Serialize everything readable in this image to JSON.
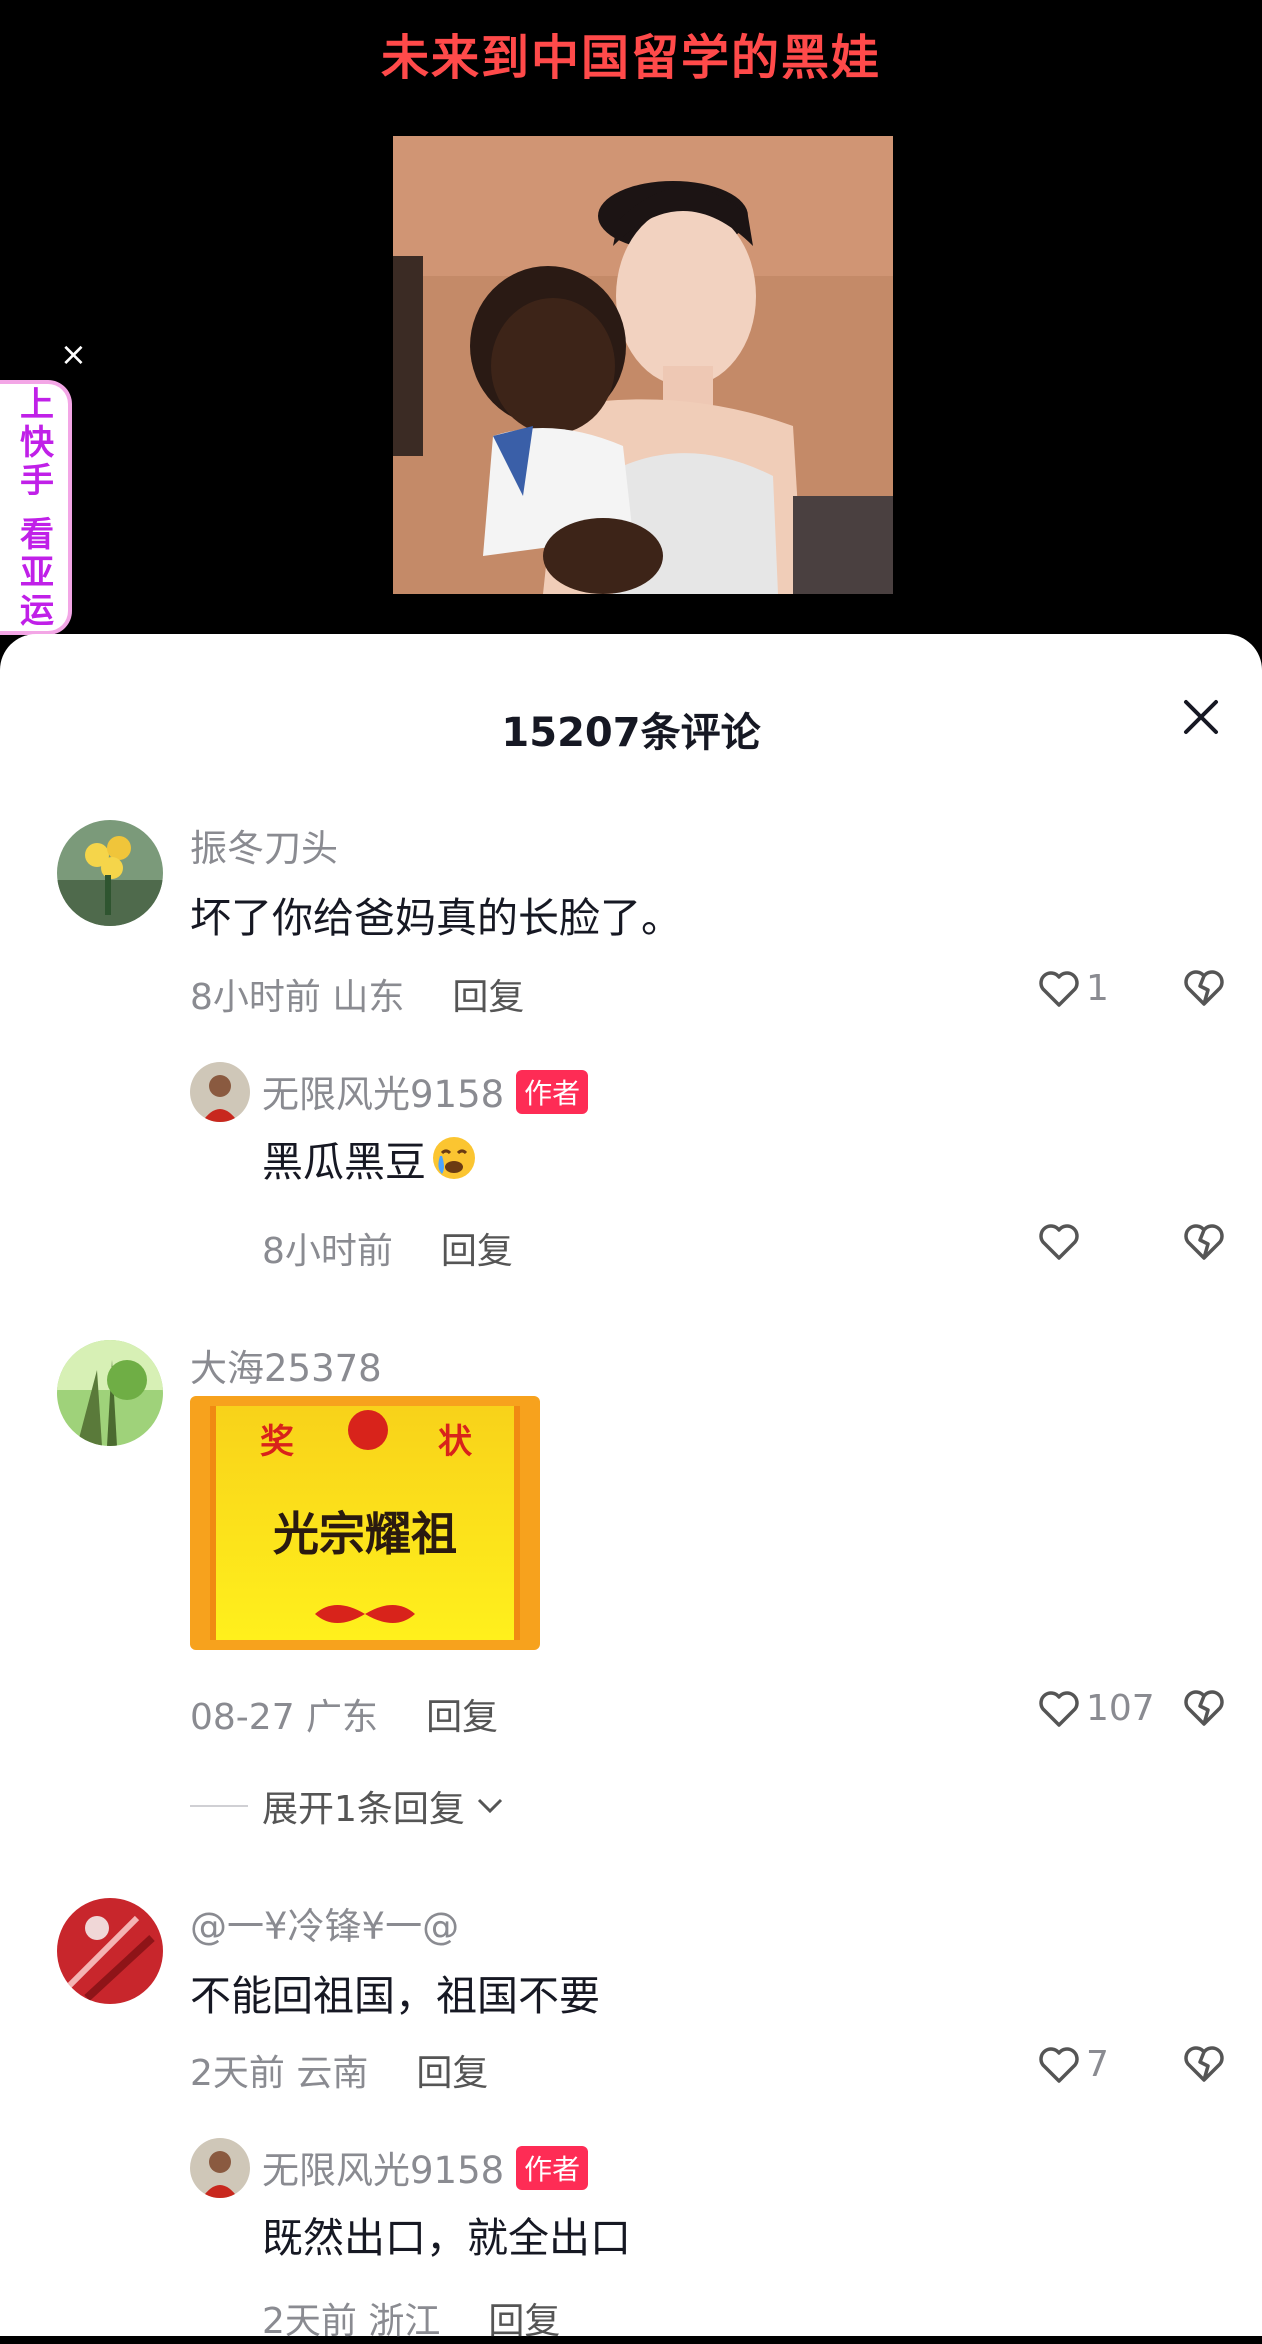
{
  "video": {
    "title": "未来到中国留学的黑娃"
  },
  "promo": {
    "close_label": "×",
    "text": "上快手 看亚运"
  },
  "sheet": {
    "title": "15207条评论"
  },
  "comments": [
    {
      "username": "振冬刀头",
      "text": "坏了你给爸妈真的长脸了。",
      "meta": "8小时前 山东",
      "reply_label": "回复",
      "likes": "1"
    },
    {
      "username": "无限风光9158",
      "badge": "作者",
      "text": "黑瓜黑豆",
      "meta": "8小时前",
      "reply_label": "回复",
      "likes": ""
    },
    {
      "username": "大海25378",
      "sticker_text": "光宗耀祖",
      "sticker_header_left": "奖",
      "sticker_header_right": "状",
      "meta": "08-27 广东",
      "reply_label": "回复",
      "likes": "107",
      "expand_label": "展开1条回复"
    },
    {
      "username": "@一¥冷锋¥一@",
      "text": "不能回祖国，祖国不要",
      "meta": "2天前 云南",
      "reply_label": "回复",
      "likes": "7"
    },
    {
      "username": "无限风光9158",
      "badge": "作者",
      "text": "既然出口，就全出口",
      "meta": "2天前 浙江",
      "reply_label": "回复"
    }
  ],
  "colors": {
    "title_red": "#ff4a4a",
    "author_badge": "#fe2c55",
    "promo_purple": "#c020e8"
  }
}
